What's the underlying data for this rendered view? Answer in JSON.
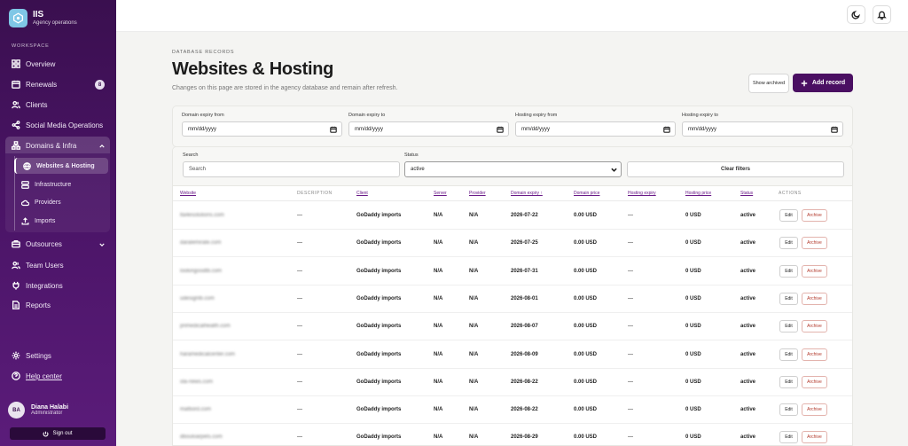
{
  "brand": {
    "title": "IIS",
    "subtitle": "Agency operations"
  },
  "sidebar": {
    "section_label": "WORKSPACE",
    "items": [
      {
        "label": "Overview",
        "icon": "grid-icon"
      },
      {
        "label": "Renewals",
        "icon": "calendar-icon",
        "badge": "8"
      },
      {
        "label": "Clients",
        "icon": "users-icon"
      },
      {
        "label": "Social Media Operations",
        "icon": "share-icon"
      },
      {
        "label": "Domains & Infra",
        "icon": "network-icon"
      },
      {
        "label": "Outsources",
        "icon": "briefcase-icon"
      },
      {
        "label": "Team Users",
        "icon": "team-icon"
      },
      {
        "label": "Integrations",
        "icon": "plug-icon"
      },
      {
        "label": "Reports",
        "icon": "report-icon"
      }
    ],
    "sub_items": [
      {
        "label": "Websites & Hosting",
        "icon": "globe-icon"
      },
      {
        "label": "Infrastructure",
        "icon": "server-icon"
      },
      {
        "label": "Providers",
        "icon": "cloud-icon"
      },
      {
        "label": "Imports",
        "icon": "upload-icon"
      }
    ],
    "settings_label": "Settings",
    "help_label": "Help center",
    "user": {
      "initials": "BA",
      "name": "Diana Halabi",
      "role": "Administrator"
    },
    "signout_label": "Sign out"
  },
  "header": {
    "eyebrow": "DATABASE RECORDS",
    "title": "Websites & Hosting",
    "subtitle": "Changes on this page are stored in the agency database and remain after refresh.",
    "show_archived_label": "Show archived",
    "add_record_label": "Add record"
  },
  "filters": {
    "domain_from_label": "Domain expiry from",
    "domain_to_label": "Domain expiry to",
    "hosting_from_label": "Hosting expiry from",
    "hosting_to_label": "Hosting expiry to",
    "date_placeholder": "mm/dd/yyyy",
    "search_label": "Search",
    "search_placeholder": "Search",
    "status_label": "Status",
    "status_value": "active",
    "clear_label": "Clear filters"
  },
  "table": {
    "columns": [
      "Website",
      "DESCRIPTION",
      "Client",
      "Server",
      "Provider",
      "Domain expiry ↑",
      "Domain price",
      "Hosting expiry",
      "Hosting price",
      "Status",
      "ACTIONS"
    ],
    "edit_label": "Edit",
    "archive_label": "Archive",
    "rows": [
      {
        "website": "lta4esolutions.com",
        "description": "—",
        "client": "GoDaddy imports",
        "server": "N/A",
        "provider": "N/A",
        "domain_expiry": "2026-07-22",
        "domain_price": "0.00 USD",
        "hosting_expiry": "—",
        "hosting_price": "0 USD",
        "status": "active"
      },
      {
        "website": "daralemirate.com",
        "description": "—",
        "client": "GoDaddy imports",
        "server": "N/A",
        "provider": "N/A",
        "domain_expiry": "2026-07-25",
        "domain_price": "0.00 USD",
        "hosting_expiry": "—",
        "hosting_price": "0 USD",
        "status": "active"
      },
      {
        "website": "lookingoodtb.com",
        "description": "—",
        "client": "GoDaddy imports",
        "server": "N/A",
        "provider": "N/A",
        "domain_expiry": "2026-07-31",
        "domain_price": "0.00 USD",
        "hosting_expiry": "—",
        "hosting_price": "0 USD",
        "status": "active"
      },
      {
        "website": "udesignlb.com",
        "description": "—",
        "client": "GoDaddy imports",
        "server": "N/A",
        "provider": "N/A",
        "domain_expiry": "2026-08-01",
        "domain_price": "0.00 USD",
        "hosting_expiry": "—",
        "hosting_price": "0 USD",
        "status": "active"
      },
      {
        "website": "primedicalhealth.com",
        "description": "—",
        "client": "GoDaddy imports",
        "server": "N/A",
        "provider": "N/A",
        "domain_expiry": "2026-08-07",
        "domain_price": "0.00 USD",
        "hosting_expiry": "—",
        "hosting_price": "0 USD",
        "status": "active"
      },
      {
        "website": "haramedicalcenter.com",
        "description": "—",
        "client": "GoDaddy imports",
        "server": "N/A",
        "provider": "N/A",
        "domain_expiry": "2026-08-09",
        "domain_price": "0.00 USD",
        "hosting_expiry": "—",
        "hosting_price": "0 USD",
        "status": "active"
      },
      {
        "website": "ola-news.com",
        "description": "—",
        "client": "GoDaddy imports",
        "server": "N/A",
        "provider": "N/A",
        "domain_expiry": "2026-08-22",
        "domain_price": "0.00 USD",
        "hosting_expiry": "—",
        "hosting_price": "0 USD",
        "status": "active"
      },
      {
        "website": "mafbord.com",
        "description": "—",
        "client": "GoDaddy imports",
        "server": "N/A",
        "provider": "N/A",
        "domain_expiry": "2026-08-22",
        "domain_price": "0.00 USD",
        "hosting_expiry": "—",
        "hosting_price": "0 USD",
        "status": "active"
      },
      {
        "website": "dbouloarpets.com",
        "description": "—",
        "client": "GoDaddy imports",
        "server": "N/A",
        "provider": "N/A",
        "domain_expiry": "2026-08-29",
        "domain_price": "0.00 USD",
        "hosting_expiry": "—",
        "hosting_price": "0 USD",
        "status": "active"
      }
    ]
  },
  "topbar": {
    "theme_icon": "moon-icon",
    "notif_icon": "bell-icon"
  },
  "colors": {
    "accent": "#4a0f62",
    "archive": "#b33a2d"
  }
}
